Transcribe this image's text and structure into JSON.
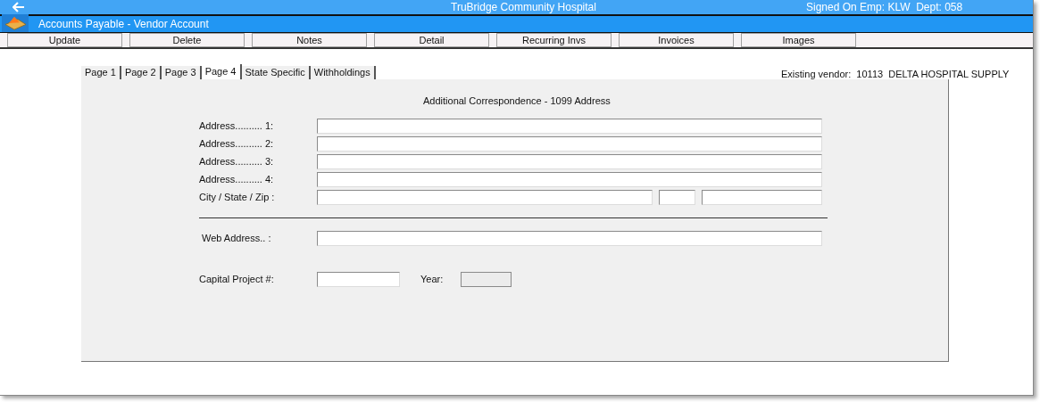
{
  "app_bar": {
    "title": "TruBridge Community Hospital",
    "signed_on": "Signed On Emp: KLW  Dept: 058"
  },
  "window": {
    "title": "Accounts Payable - Vendor Account"
  },
  "toolbar": [
    "Update",
    "Delete",
    "Notes",
    "Detail",
    "Recurring Invs",
    "Invoices",
    "Images"
  ],
  "tabs": [
    {
      "label": "Page 1",
      "selected": false
    },
    {
      "label": "Page 2",
      "selected": false
    },
    {
      "label": "Page 3",
      "selected": false
    },
    {
      "label": "Page 4",
      "selected": true
    },
    {
      "label": "State Specific",
      "selected": false
    },
    {
      "label": "Withholdings",
      "selected": false
    }
  ],
  "vendor": "Existing vendor:  10113  DELTA HOSPITAL SUPPLY",
  "form": {
    "heading": "Additional Correspondence - 1099 Address",
    "address_rows": [
      {
        "label": "Address.......... 1:"
      },
      {
        "label": "Address.......... 2:"
      },
      {
        "label": "Address.......... 3:"
      },
      {
        "label": "Address.......... 4:"
      }
    ],
    "city_label": "City / State / Zip :",
    "web_label": "Web Address.. :",
    "capital_label": "Capital Project #:",
    "year": {
      "label": "Year:",
      "disabled": true
    }
  }
}
